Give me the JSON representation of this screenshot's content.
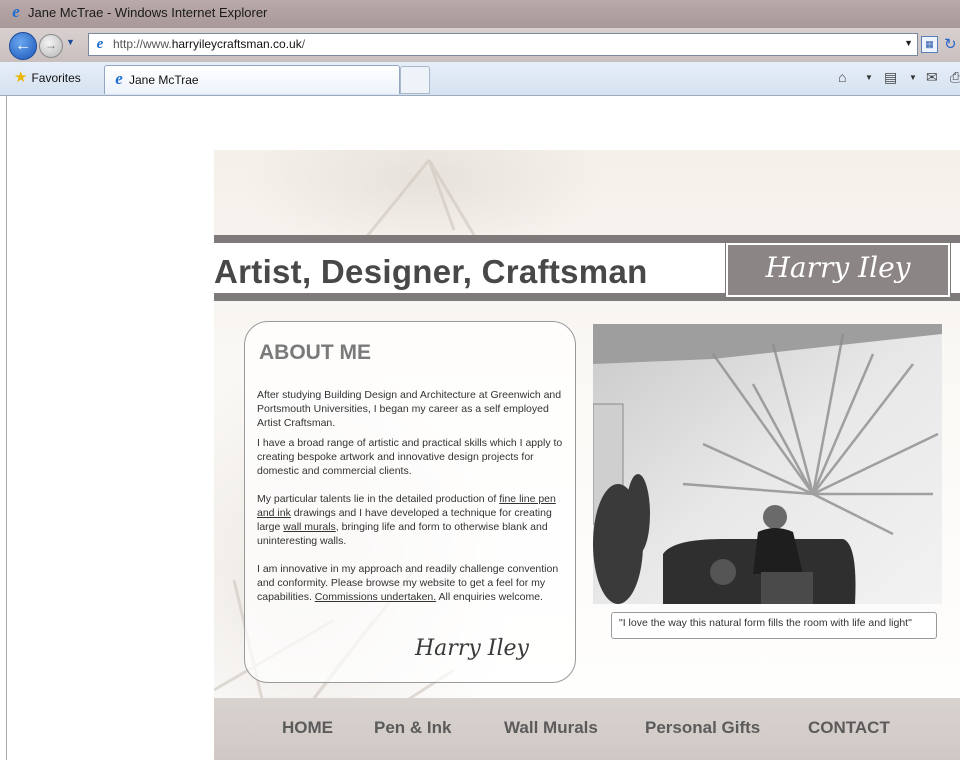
{
  "window": {
    "title": "Jane McTrae - Windows Internet Explorer",
    "app_icon": "ie-logo-icon"
  },
  "navigation": {
    "url_scheme": "http://www.",
    "url_host": "harryileycraftsman.co.uk",
    "url_path": "/"
  },
  "tabs": {
    "favorites_label": "Favorites",
    "active_tab_label": "Jane McTrae"
  },
  "site": {
    "tagline": "Artist, Designer, Craftsman",
    "logo_text": "Harry Iley",
    "about": {
      "title": "ABOUT ME",
      "p1": "After studying  Building Design and Architecture at Greenwich and Portsmouth Universities, I began  my career as a self employed Artist Craftsman.",
      "p2": "I have a broad range of artistic and practical skills which I apply to creating bespoke artwork and innovative design projects for domestic and commercial clients.",
      "p3_a": "My particular talents lie in the detailed production of ",
      "p3_link1": "fine line pen and ink",
      "p3_b": " drawings and  I have developed a technique for creating large ",
      "p3_link2": "wall murals",
      "p3_c": ", bringing life and form to otherwise blank and uninteresting walls.",
      "p4_a": "I am innovative in my approach  and readily challenge convention and conformity.   Please browse my  website to get a feel for my capabilities.   ",
      "p4_link": "Commissions undertaken.",
      "p4_b": " All enquiries welcome.",
      "signature": "Harry Iley"
    },
    "caption": "\"I love the way this natural form fills the room with life and light\"",
    "nav": {
      "home": "HOME",
      "pen_ink": "Pen & Ink",
      "wall_murals": "Wall Murals",
      "personal_gifts": "Personal Gifts",
      "contact": "CONTACT"
    }
  },
  "colors": {
    "band": "#7f7a7a",
    "logo_bg": "#8c8585",
    "tagline": "#484848",
    "nav_bg": "#d4cdc9",
    "nav_text": "#5b5b5b"
  }
}
